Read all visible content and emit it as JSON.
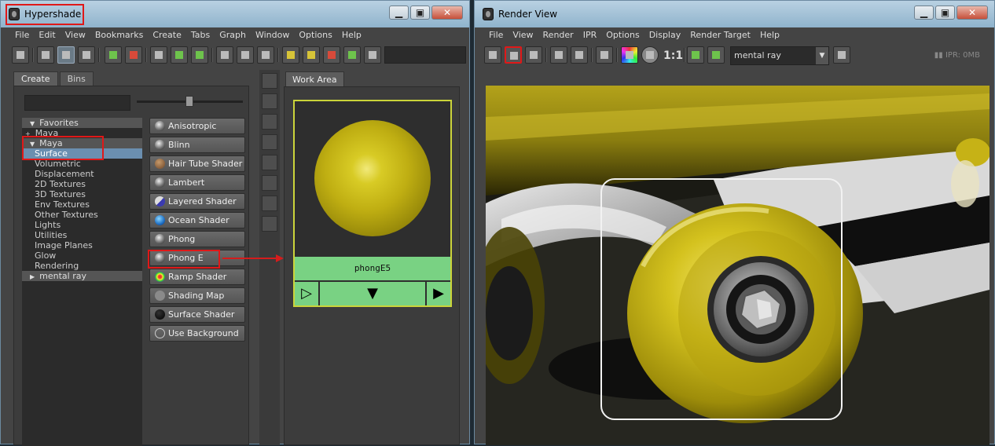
{
  "hypershade": {
    "title": "Hypershade",
    "menu": [
      "File",
      "Edit",
      "View",
      "Bookmarks",
      "Create",
      "Tabs",
      "Graph",
      "Window",
      "Options",
      "Help"
    ],
    "tabs": [
      "Create",
      "Bins"
    ],
    "tree": [
      {
        "label": "Favorites",
        "indent": 2,
        "kind": "header",
        "prefix": "▼"
      },
      {
        "label": "Maya",
        "indent": 1,
        "kind": "plain",
        "prefix": "+"
      },
      {
        "label": "Maya",
        "indent": 2,
        "kind": "header",
        "prefix": "▼"
      },
      {
        "label": "Surface",
        "indent": 3,
        "kind": "selected",
        "prefix": ""
      },
      {
        "label": "Volumetric",
        "indent": 3,
        "kind": "plain",
        "prefix": ""
      },
      {
        "label": "Displacement",
        "indent": 3,
        "kind": "plain",
        "prefix": ""
      },
      {
        "label": "2D Textures",
        "indent": 3,
        "kind": "plain",
        "prefix": ""
      },
      {
        "label": "3D Textures",
        "indent": 3,
        "kind": "plain",
        "prefix": ""
      },
      {
        "label": "Env Textures",
        "indent": 3,
        "kind": "plain",
        "prefix": ""
      },
      {
        "label": "Other Textures",
        "indent": 3,
        "kind": "plain",
        "prefix": ""
      },
      {
        "label": "Lights",
        "indent": 3,
        "kind": "plain",
        "prefix": ""
      },
      {
        "label": "Utilities",
        "indent": 3,
        "kind": "plain",
        "prefix": ""
      },
      {
        "label": "Image Planes",
        "indent": 3,
        "kind": "plain",
        "prefix": ""
      },
      {
        "label": "Glow",
        "indent": 3,
        "kind": "plain",
        "prefix": ""
      },
      {
        "label": "Rendering",
        "indent": 3,
        "kind": "plain",
        "prefix": ""
      },
      {
        "label": "mental ray",
        "indent": 2,
        "kind": "header",
        "prefix": "▶"
      }
    ],
    "shaders": [
      {
        "label": "Anisotropic",
        "icon": "gray-sphere"
      },
      {
        "label": "Blinn",
        "icon": "gray-sphere"
      },
      {
        "label": "Hair Tube Shader",
        "icon": "hair-icon"
      },
      {
        "label": "Lambert",
        "icon": "gray-sphere"
      },
      {
        "label": "Layered Shader",
        "icon": "layered-icon"
      },
      {
        "label": "Ocean Shader",
        "icon": "ocean-icon"
      },
      {
        "label": "Phong",
        "icon": "gray-sphere"
      },
      {
        "label": "Phong E",
        "icon": "gray-sphere"
      },
      {
        "label": "Ramp Shader",
        "icon": "ramp-icon"
      },
      {
        "label": "Shading Map",
        "icon": "flat-gray-icon"
      },
      {
        "label": "Surface Shader",
        "icon": "black-sphere"
      },
      {
        "label": "Use Background",
        "icon": "hollow-circle"
      }
    ],
    "work_area": {
      "tab_label": "Work Area",
      "swatch_label": "phongE5",
      "ctrl_left": "▷",
      "ctrl_mid": "▼",
      "ctrl_right": "▶"
    }
  },
  "render_view": {
    "title": "Render View",
    "menu": [
      "File",
      "View",
      "Render",
      "IPR",
      "Options",
      "Display",
      "Render Target",
      "Help"
    ],
    "renderer": "mental ray",
    "dropdown_arrow": "▼",
    "ratio": "1:1",
    "ipr_status": "IPR: 0MB",
    "pause": "▮▮"
  },
  "window_buttons": {
    "minimize": "▁",
    "maximize": "▣",
    "close": "✕"
  },
  "colors": {
    "accent_red": "#e01818",
    "swatch_green": "#79d283",
    "wheel_yellow": "#c9b40f",
    "selection_blue": "#6b8fb0"
  }
}
